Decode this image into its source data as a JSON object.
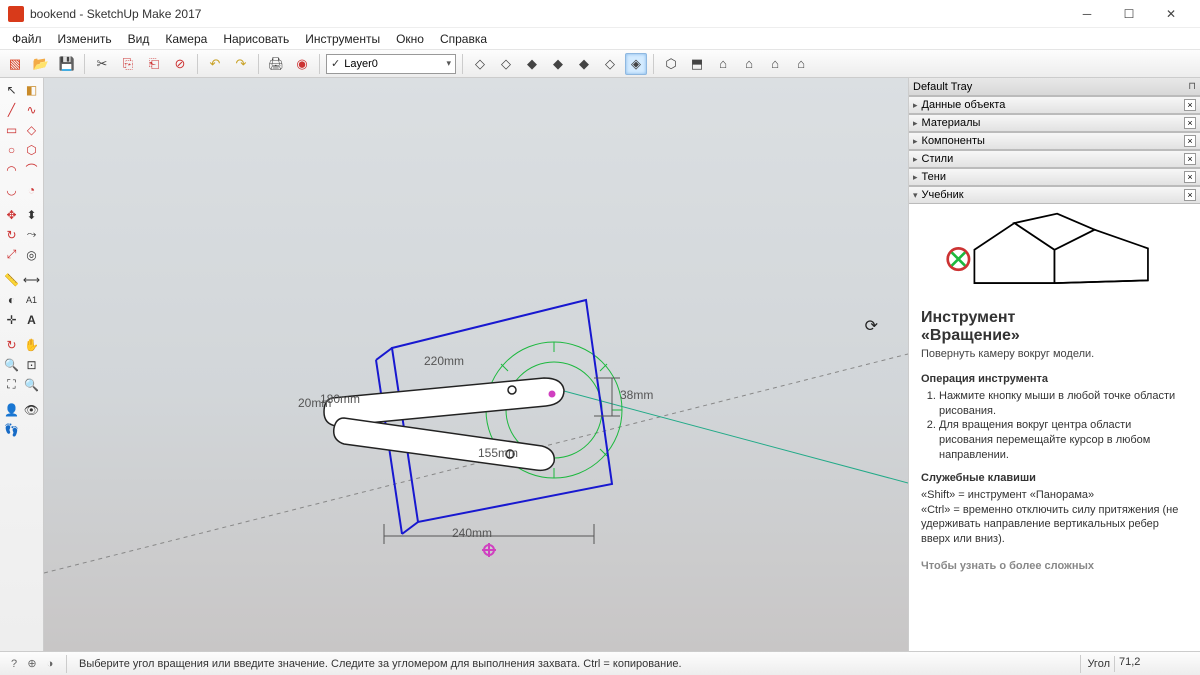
{
  "title": "bookend - SketchUp Make 2017",
  "menus": [
    "Файл",
    "Изменить",
    "Вид",
    "Камера",
    "Нарисовать",
    "Инструменты",
    "Окно",
    "Справка"
  ],
  "layer_selected": "Layer0",
  "tray_title": "Default Tray",
  "panels": [
    {
      "label": "Данные объекта"
    },
    {
      "label": "Материалы"
    },
    {
      "label": "Компоненты"
    },
    {
      "label": "Стили"
    },
    {
      "label": "Тени"
    },
    {
      "label": "Учебник"
    }
  ],
  "instructor": {
    "title1": "Инструмент",
    "title2": "«Вращение»",
    "desc": "Повернуть камеру вокруг модели.",
    "sec1": "Операция инструмента",
    "step1": "Нажмите кнопку мыши в любой точке области рисования.",
    "step2": "Для вращения вокруг центра области рисования перемещайте курсор в любом направлении.",
    "sec2": "Служебные клавиши",
    "key1": "«Shift» = инструмент «Панорама»",
    "key2": "«Ctrl» = временно отключить силу притяжения (не удерживать направление вертикальных ребер вверх или вниз).",
    "cutoff": "Чтобы узнать о более сложных"
  },
  "status": {
    "msg": "Выберите угол вращения или введите значение.  Следите за угломером для выполнения захвата. Ctrl = копирование.",
    "angle_label": "Угол",
    "angle_value": "71,2"
  },
  "dimensions": {
    "d1": "220mm",
    "d2": "180mm",
    "d3": "20mm",
    "d4": "38mm",
    "d5": "155mm",
    "d6": "240mm"
  }
}
